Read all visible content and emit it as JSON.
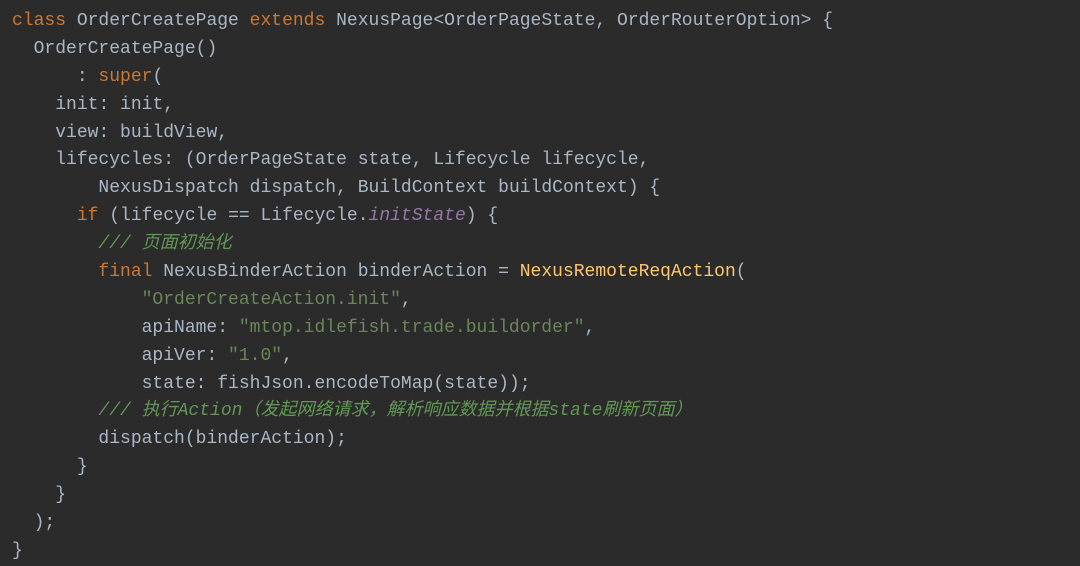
{
  "code": {
    "line1": {
      "class_kw": "class",
      "class_name": "OrderCreatePage",
      "extends_kw": "extends",
      "base_type": "NexusPage",
      "generic1": "OrderPageState",
      "generic2": "OrderRouterOption"
    },
    "line2": {
      "constructor": "OrderCreatePage"
    },
    "line3": {
      "super_kw": "super"
    },
    "line4": {
      "param": "init",
      "value": "init"
    },
    "line5": {
      "param": "view",
      "value": "buildView"
    },
    "line6": {
      "param": "lifecycles",
      "type1": "OrderPageState",
      "arg1": "state",
      "type2": "Lifecycle",
      "arg2": "lifecycle"
    },
    "line7": {
      "type1": "NexusDispatch",
      "arg1": "dispatch",
      "type2": "BuildContext",
      "arg2": "buildContext"
    },
    "line8": {
      "if_kw": "if",
      "var": "lifecycle",
      "op": "==",
      "class": "Lifecycle",
      "prop": "initState"
    },
    "line9": {
      "comment": "/// 页面初始化"
    },
    "line10": {
      "final_kw": "final",
      "type": "NexusBinderAction",
      "var": "binderAction",
      "ctor": "NexusRemoteReqAction"
    },
    "line11": {
      "string": "\"OrderCreateAction.init\""
    },
    "line12": {
      "param": "apiName",
      "string": "\"mtop.idlefish.trade.buildorder\""
    },
    "line13": {
      "param": "apiVer",
      "string": "\"1.0\""
    },
    "line14": {
      "param": "state",
      "obj": "fishJson",
      "method": "encodeToMap",
      "arg": "state"
    },
    "line15": {
      "comment": "/// 执行Action（发起网络请求，解析响应数据并根据state刷新页面）"
    },
    "line16": {
      "func": "dispatch",
      "arg": "binderAction"
    }
  }
}
